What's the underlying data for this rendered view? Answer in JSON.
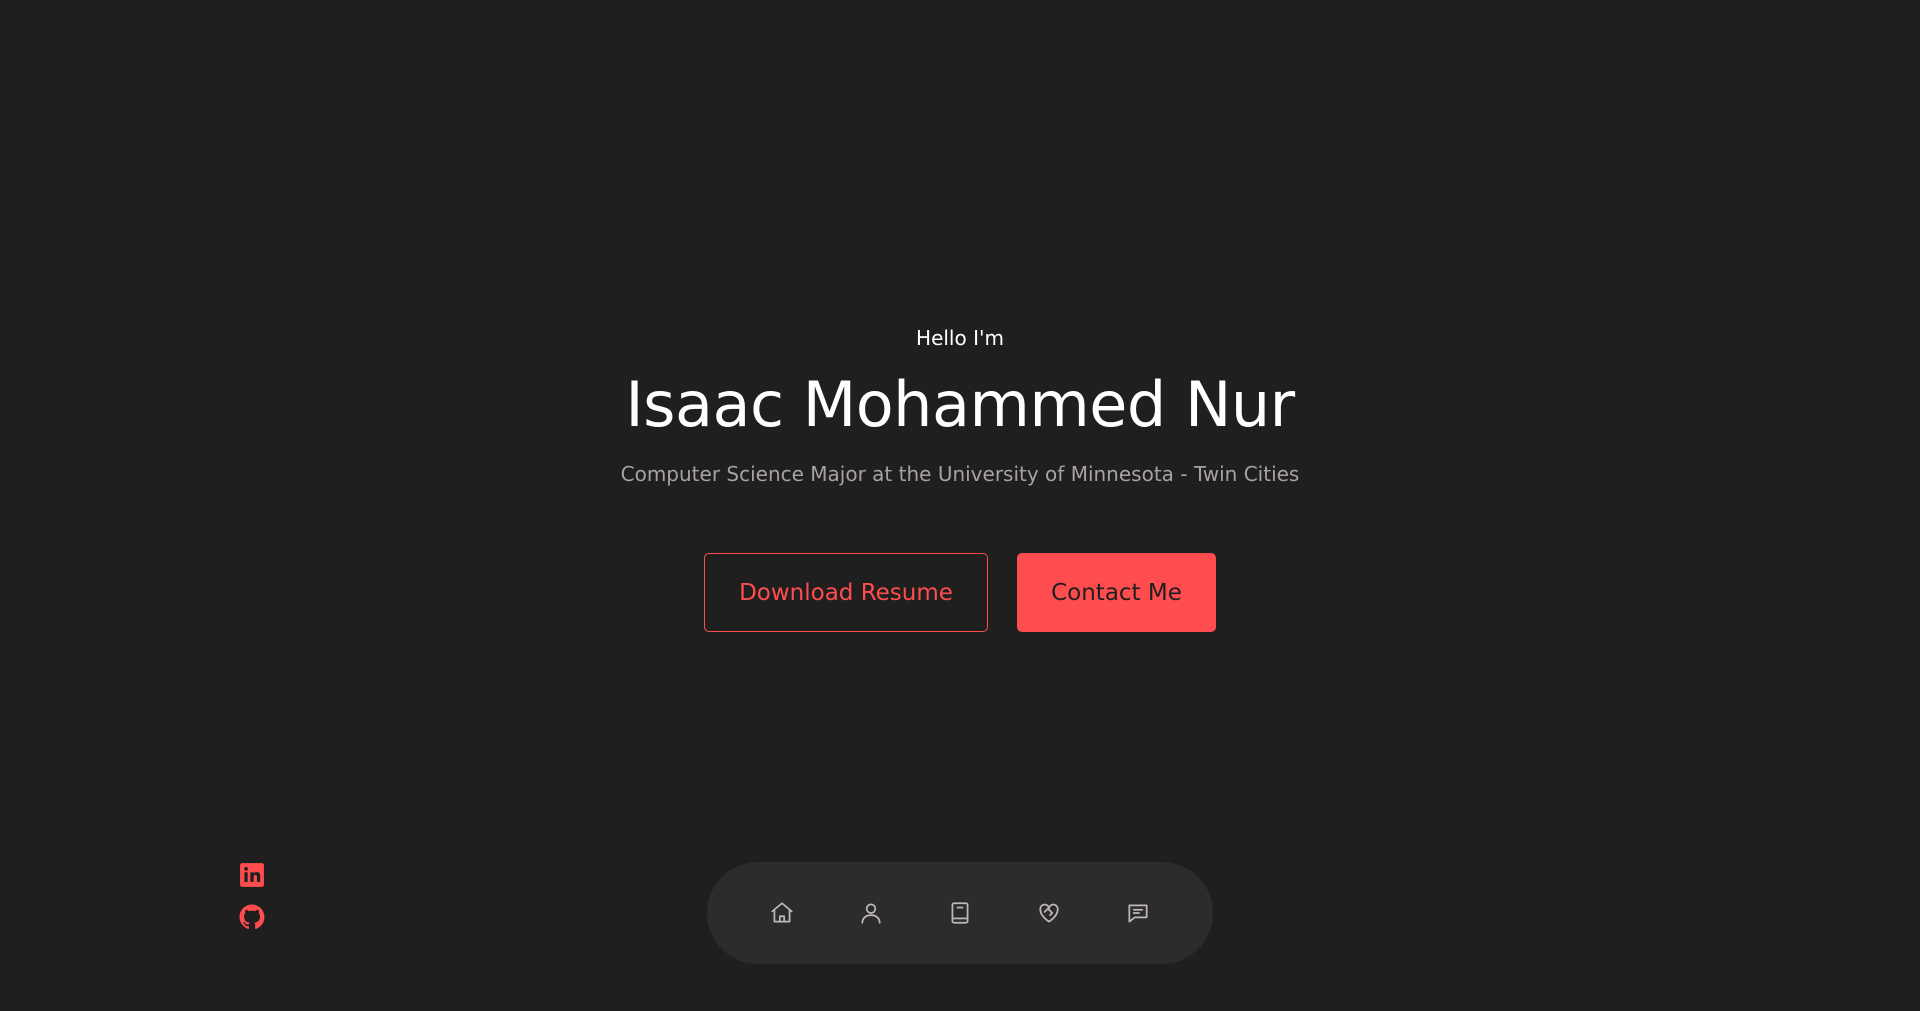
{
  "hero": {
    "greeting": "Hello I'm",
    "name": "Isaac Mohammed Nur",
    "subtitle": "Computer Science Major at the University of Minnesota - Twin Cities"
  },
  "buttons": {
    "download_label": "Download Resume",
    "contact_label": "Contact Me"
  },
  "socials": [
    {
      "icon": "linkedin-icon"
    },
    {
      "icon": "github-icon"
    }
  ],
  "nav": [
    {
      "icon": "home-icon"
    },
    {
      "icon": "user-icon"
    },
    {
      "icon": "book-icon"
    },
    {
      "icon": "heart-handshake-icon"
    },
    {
      "icon": "message-icon"
    }
  ],
  "colors": {
    "background": "#1e1f1e",
    "accent": "#ff4d4f",
    "muted_text": "#a9a1a1",
    "nav_background": "#2c2c2c",
    "nav_icon": "#c0b8b8"
  }
}
